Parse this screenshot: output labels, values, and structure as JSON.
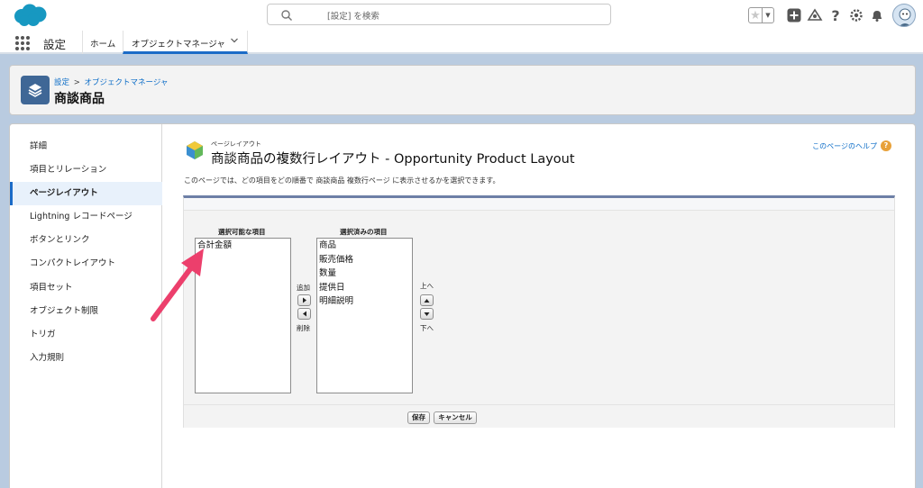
{
  "header": {
    "search_placeholder": "[設定] を検索"
  },
  "app_nav": {
    "app_name": "設定",
    "home_tab": "ホーム",
    "object_manager_tab": "オブジェクトマネージャ"
  },
  "page_header": {
    "breadcrumb_setup": "設定",
    "breadcrumb_sep": ">",
    "breadcrumb_object_manager": "オブジェクトマネージャ",
    "title": "商談商品"
  },
  "sidebar": {
    "items": [
      {
        "label": "詳細"
      },
      {
        "label": "項目とリレーション"
      },
      {
        "label": "ページレイアウト"
      },
      {
        "label": "Lightning レコードページ"
      },
      {
        "label": "ボタンとリンク"
      },
      {
        "label": "コンパクトレイアウト"
      },
      {
        "label": "項目セット"
      },
      {
        "label": "オブジェクト制限"
      },
      {
        "label": "トリガ"
      },
      {
        "label": "入力規則"
      }
    ],
    "active_index": 2
  },
  "content": {
    "page_type": "ページレイアウト",
    "title": "商談商品の複数行レイアウト - Opportunity Product Layout",
    "help_link": "このページのヘルプ",
    "description": "このページでは、どの項目をどの順番で 商談商品 複数行ページ に表示させるかを選択できます。"
  },
  "duel_list": {
    "available_label": "選択可能な項目",
    "available_items": [
      "合計金額"
    ],
    "selected_label": "選択済みの項目",
    "selected_items": [
      "商品",
      "販売価格",
      "数量",
      "提供日",
      "明細説明"
    ],
    "add_label": "追加",
    "remove_label": "削除",
    "up_label": "上へ",
    "down_label": "下へ"
  },
  "buttons": {
    "save": "保存",
    "cancel": "キャンセル"
  },
  "colors": {
    "accent": "#1b6bc7",
    "annotation_arrow": "#ec3f6c",
    "page_background": "#b9cbe0"
  }
}
